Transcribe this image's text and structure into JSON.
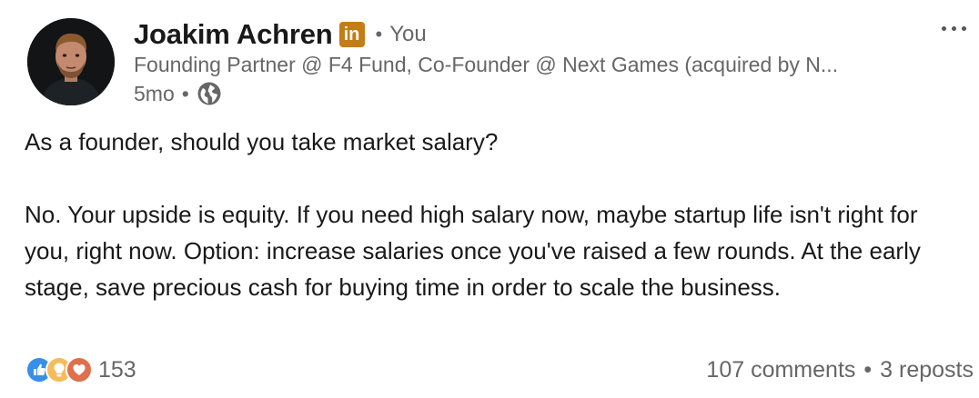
{
  "author": {
    "name": "Joakim Achren",
    "badge": "in",
    "relation_separator": "•",
    "relation": "You",
    "headline": "Founding Partner @ F4 Fund, Co-Founder @ Next Games (acquired by N...",
    "time_ago": "5mo",
    "meta_separator": "•",
    "visibility_icon": "globe-icon"
  },
  "colors": {
    "badge": "#c37d16",
    "secondary_text": "#666666",
    "like": "#378fe9",
    "insightful": "#f5bb5c",
    "love": "#df704d"
  },
  "post": {
    "paragraphs": [
      "As a founder, should you take market salary?",
      "No. Your upside is equity. If you need high salary now, maybe startup life isn't right for you, right now. Option: increase salaries once you've raised a few rounds. At the early stage, save precious cash for buying time in order to scale the business."
    ]
  },
  "social": {
    "reaction_icons": [
      "like-icon",
      "insightful-icon",
      "love-icon"
    ],
    "reactions_count": "153",
    "comments": "107 comments",
    "separator": "•",
    "reposts": "3 reposts"
  }
}
